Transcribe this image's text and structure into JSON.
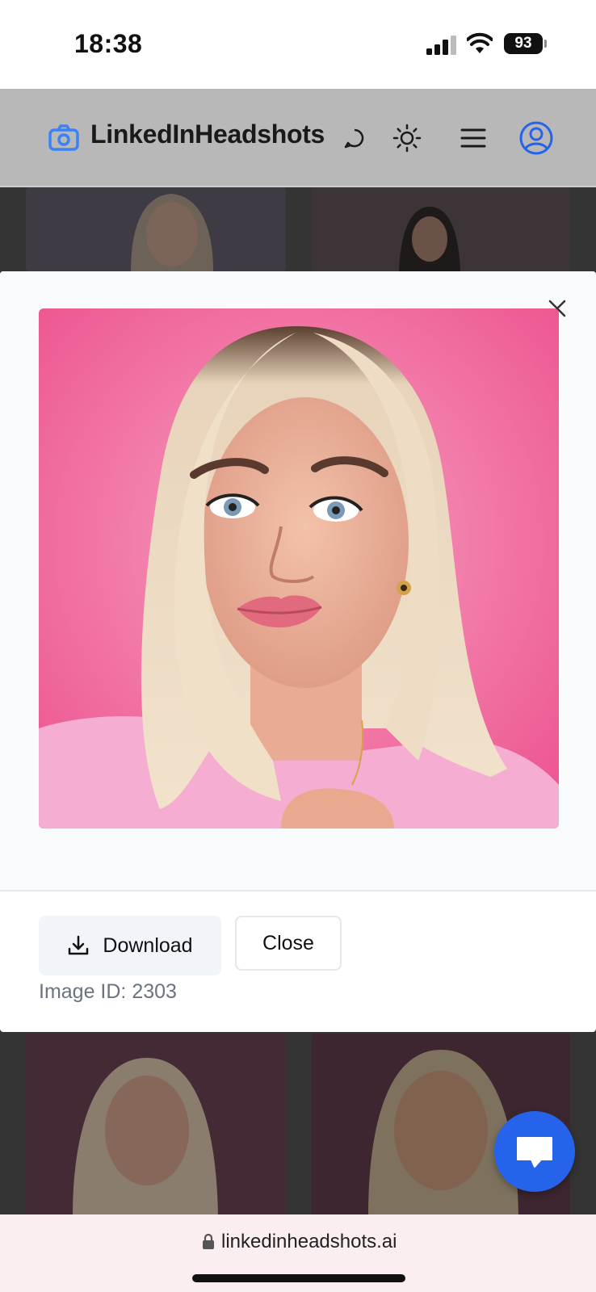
{
  "status_bar": {
    "time": "18:38",
    "battery": "93"
  },
  "header": {
    "brand": "LinkedInHeadshots",
    "icons": [
      "camera-icon",
      "chat-bubble-icon",
      "sun-icon",
      "menu-icon",
      "user-circle-icon"
    ]
  },
  "modal": {
    "download_label": "Download",
    "close_label": "Close",
    "image_id": "Image ID: 2303"
  },
  "browser": {
    "url": "linkedinheadshots.ai"
  },
  "colors": {
    "accent": "#2563eb",
    "photo_background": "#f0629a",
    "header_overlay": "#b8b8b8"
  }
}
